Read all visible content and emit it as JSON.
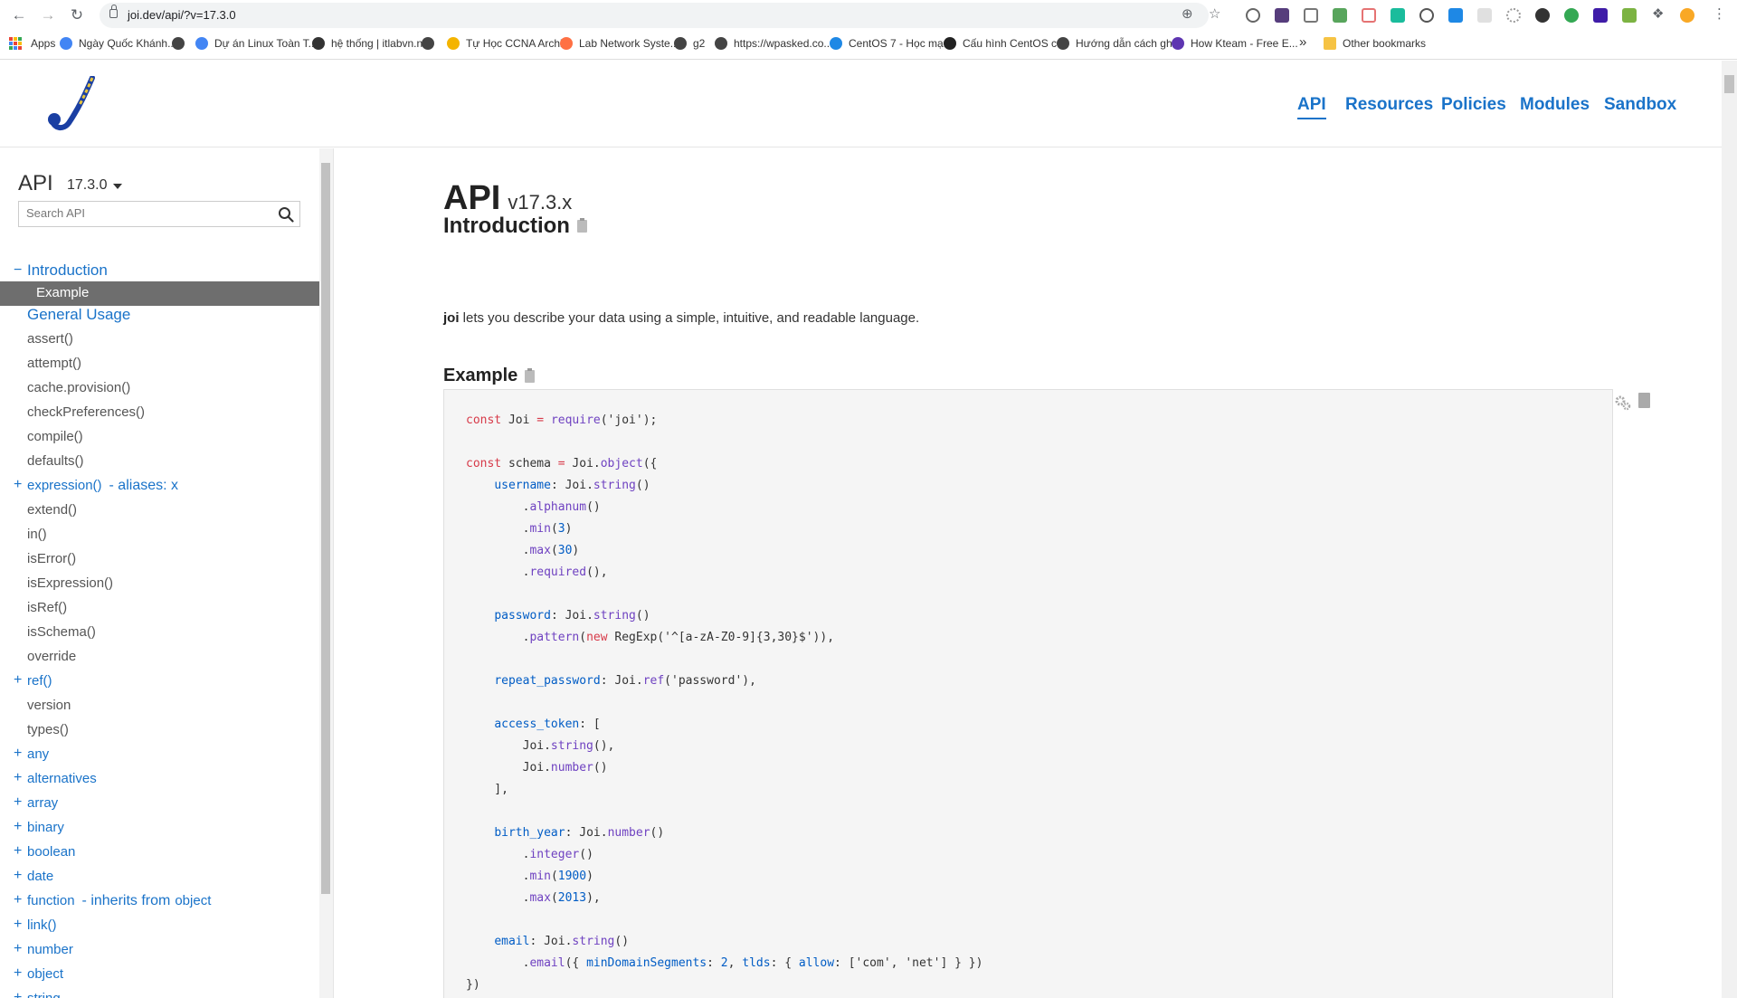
{
  "browser": {
    "url": "joi.dev/api/?v=17.3.0",
    "bookmarks": [
      {
        "label": "Apps"
      },
      {
        "label": "Ngày Quốc Khánh..."
      },
      {
        "label": ""
      },
      {
        "label": "Dự án Linux Toàn T..."
      },
      {
        "label": "hệ thống | itlabvn.net"
      },
      {
        "label": ""
      },
      {
        "label": "Tự Học CCNA Archi..."
      },
      {
        "label": "Lab Network Syste..."
      },
      {
        "label": "g2"
      },
      {
        "label": "https://wpasked.co..."
      },
      {
        "label": "CentOS 7 - Học mạ..."
      },
      {
        "label": "Cấu hình CentOS c..."
      },
      {
        "label": "Hướng dẫn cách gh..."
      },
      {
        "label": "How Kteam - Free E..."
      }
    ],
    "more_bookmarks": "»",
    "other_bookmarks": "Other bookmarks"
  },
  "header": {
    "nav": [
      {
        "label": "API",
        "active": true
      },
      {
        "label": "Resources"
      },
      {
        "label": "Policies"
      },
      {
        "label": "Modules"
      },
      {
        "label": "Sandbox"
      }
    ]
  },
  "sidebar": {
    "title": "API",
    "version": "17.3.0",
    "search_placeholder": "Search API",
    "items": [
      {
        "marker": "−",
        "label": "Introduction"
      },
      {
        "marker": "",
        "label": "Example"
      },
      {
        "marker": "",
        "label": "General Usage"
      },
      {
        "marker": "",
        "label": "assert()"
      },
      {
        "marker": "",
        "label": "attempt()"
      },
      {
        "marker": "",
        "label": "cache.provision()"
      },
      {
        "marker": "",
        "label": "checkPreferences()"
      },
      {
        "marker": "",
        "label": "compile()"
      },
      {
        "marker": "",
        "label": "defaults()"
      },
      {
        "marker": "+",
        "label": "expression()",
        "alias": "- aliases: x"
      },
      {
        "marker": "",
        "label": "extend()"
      },
      {
        "marker": "",
        "label": "in()"
      },
      {
        "marker": "",
        "label": "isError()"
      },
      {
        "marker": "",
        "label": "isExpression()"
      },
      {
        "marker": "",
        "label": "isRef()"
      },
      {
        "marker": "",
        "label": "isSchema()"
      },
      {
        "marker": "",
        "label": "override"
      },
      {
        "marker": "+",
        "label": "ref()"
      },
      {
        "marker": "",
        "label": "version"
      },
      {
        "marker": "",
        "label": "types()"
      },
      {
        "marker": "+",
        "label": "any"
      },
      {
        "marker": "+",
        "label": "alternatives"
      },
      {
        "marker": "+",
        "label": "array"
      },
      {
        "marker": "+",
        "label": "binary"
      },
      {
        "marker": "+",
        "label": "boolean"
      },
      {
        "marker": "+",
        "label": "date"
      },
      {
        "marker": "+",
        "label": "function",
        "alias": "- inherits from",
        "alias_obj": "object"
      },
      {
        "marker": "+",
        "label": "link()"
      },
      {
        "marker": "+",
        "label": "number"
      },
      {
        "marker": "+",
        "label": "object"
      },
      {
        "marker": "+",
        "label": "string"
      }
    ]
  },
  "content": {
    "title": "API",
    "title_version": "v17.3.x",
    "intro_heading": "Introduction",
    "intro_strong": "joi",
    "intro_text": " lets you describe your data using a simple, intuitive, and readable language.",
    "example_heading": "Example",
    "code_lines": [
      [
        [
          "kw",
          "const"
        ],
        [
          "st",
          " Joi "
        ],
        [
          "kw",
          "="
        ],
        [
          "st",
          " "
        ],
        [
          "fn",
          "require"
        ],
        [
          "st",
          "('joi');"
        ]
      ],
      [],
      [
        [
          "kw",
          "const"
        ],
        [
          "st",
          " schema "
        ],
        [
          "kw",
          "="
        ],
        [
          "st",
          " Joi."
        ],
        [
          "fn",
          "object"
        ],
        [
          "st",
          "({"
        ]
      ],
      [
        [
          "st",
          "    "
        ],
        [
          "pr",
          "username"
        ],
        [
          "st",
          ": Joi."
        ],
        [
          "fn",
          "string"
        ],
        [
          "st",
          "()"
        ]
      ],
      [
        [
          "st",
          "        ."
        ],
        [
          "fn",
          "alphanum"
        ],
        [
          "st",
          "()"
        ]
      ],
      [
        [
          "st",
          "        ."
        ],
        [
          "fn",
          "min"
        ],
        [
          "st",
          "("
        ],
        [
          "nm",
          "3"
        ],
        [
          "st",
          ")"
        ]
      ],
      [
        [
          "st",
          "        ."
        ],
        [
          "fn",
          "max"
        ],
        [
          "st",
          "("
        ],
        [
          "nm",
          "30"
        ],
        [
          "st",
          ")"
        ]
      ],
      [
        [
          "st",
          "        ."
        ],
        [
          "fn",
          "required"
        ],
        [
          "st",
          "(),"
        ]
      ],
      [],
      [
        [
          "st",
          "    "
        ],
        [
          "pr",
          "password"
        ],
        [
          "st",
          ": Joi."
        ],
        [
          "fn",
          "string"
        ],
        [
          "st",
          "()"
        ]
      ],
      [
        [
          "st",
          "        ."
        ],
        [
          "fn",
          "pattern"
        ],
        [
          "st",
          "("
        ],
        [
          "kw",
          "new"
        ],
        [
          "st",
          " RegExp('^[a-zA-Z0-9]{3,30}$')),"
        ]
      ],
      [],
      [
        [
          "st",
          "    "
        ],
        [
          "pr",
          "repeat_password"
        ],
        [
          "st",
          ": Joi."
        ],
        [
          "fn",
          "ref"
        ],
        [
          "st",
          "('password'),"
        ]
      ],
      [],
      [
        [
          "st",
          "    "
        ],
        [
          "pr",
          "access_token"
        ],
        [
          "st",
          ": ["
        ]
      ],
      [
        [
          "st",
          "        Joi."
        ],
        [
          "fn",
          "string"
        ],
        [
          "st",
          "(),"
        ]
      ],
      [
        [
          "st",
          "        Joi."
        ],
        [
          "fn",
          "number"
        ],
        [
          "st",
          "()"
        ]
      ],
      [
        [
          "st",
          "    ],"
        ]
      ],
      [],
      [
        [
          "st",
          "    "
        ],
        [
          "pr",
          "birth_year"
        ],
        [
          "st",
          ": Joi."
        ],
        [
          "fn",
          "number"
        ],
        [
          "st",
          "()"
        ]
      ],
      [
        [
          "st",
          "        ."
        ],
        [
          "fn",
          "integer"
        ],
        [
          "st",
          "()"
        ]
      ],
      [
        [
          "st",
          "        ."
        ],
        [
          "fn",
          "min"
        ],
        [
          "st",
          "("
        ],
        [
          "nm",
          "1900"
        ],
        [
          "st",
          ")"
        ]
      ],
      [
        [
          "st",
          "        ."
        ],
        [
          "fn",
          "max"
        ],
        [
          "st",
          "("
        ],
        [
          "nm",
          "2013"
        ],
        [
          "st",
          "),"
        ]
      ],
      [],
      [
        [
          "st",
          "    "
        ],
        [
          "pr",
          "email"
        ],
        [
          "st",
          ": Joi."
        ],
        [
          "fn",
          "string"
        ],
        [
          "st",
          "()"
        ]
      ],
      [
        [
          "st",
          "        ."
        ],
        [
          "fn",
          "email"
        ],
        [
          "st",
          "({ "
        ],
        [
          "pr",
          "minDomainSegments"
        ],
        [
          "st",
          ": "
        ],
        [
          "nm",
          "2"
        ],
        [
          "st",
          ", "
        ],
        [
          "pr",
          "tlds"
        ],
        [
          "st",
          ": { "
        ],
        [
          "pr",
          "allow"
        ],
        [
          "st",
          ": ['com', 'net'] } })"
        ]
      ],
      [
        [
          "st",
          "})"
        ]
      ]
    ]
  }
}
